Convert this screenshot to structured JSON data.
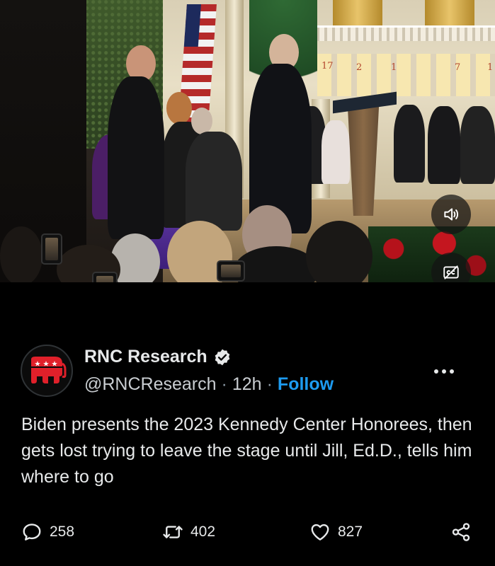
{
  "video": {
    "advent_numbers": [
      "17",
      "2",
      "1",
      "7",
      "1"
    ],
    "controls": {
      "mute_icon": "speaker-sound-icon",
      "captions_icon": "closed-captions-off-icon"
    }
  },
  "post": {
    "author": {
      "name": "RNC Research",
      "handle": "@RNCResearch",
      "verified": true,
      "avatar_icon": "gop-elephant-icon"
    },
    "time": "12h",
    "separator": "·",
    "follow_label": "Follow",
    "text": "Biden presents the 2023 Kennedy Center Honorees, then gets lost trying to leave the stage until Jill, Ed.D., tells him where to go",
    "more_icon": "more-dots-icon"
  },
  "actions": {
    "replies": "258",
    "reposts": "402",
    "likes": "827",
    "share_icon": "share-icon"
  },
  "colors": {
    "accent": "#1d9bf0",
    "background": "#000000",
    "text": "#e7e9ea",
    "secondary_text": "#8b98a5",
    "gop_red": "#e0202a"
  }
}
